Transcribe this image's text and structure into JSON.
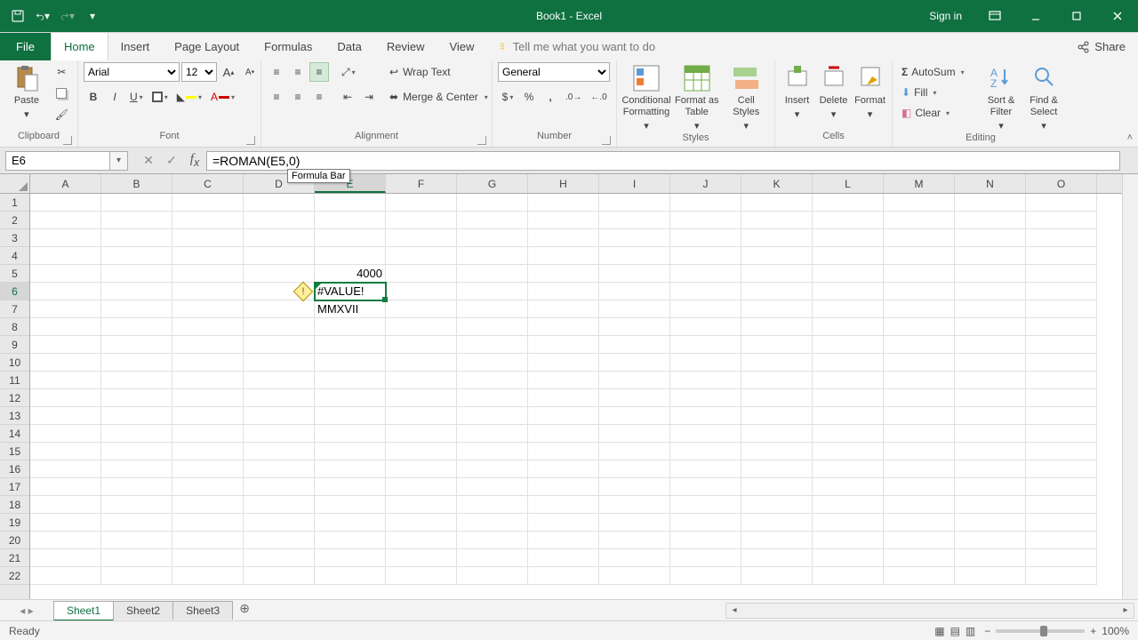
{
  "titlebar": {
    "title": "Book1 - Excel",
    "signin": "Sign in"
  },
  "tabs": {
    "file": "File",
    "home": "Home",
    "insert": "Insert",
    "pagelayout": "Page Layout",
    "formulas": "Formulas",
    "data": "Data",
    "review": "Review",
    "view": "View",
    "tellme": "Tell me what you want to do",
    "share": "Share"
  },
  "ribbon": {
    "clipboard": {
      "paste": "Paste",
      "label": "Clipboard"
    },
    "font": {
      "name": "Arial",
      "size": "12",
      "label": "Font"
    },
    "alignment": {
      "wrap": "Wrap Text",
      "merge": "Merge & Center",
      "label": "Alignment"
    },
    "number": {
      "format": "General",
      "label": "Number"
    },
    "styles": {
      "cond": "Conditional Formatting",
      "table": "Format as Table",
      "cell": "Cell Styles",
      "label": "Styles"
    },
    "cells": {
      "insert": "Insert",
      "delete": "Delete",
      "format": "Format",
      "label": "Cells"
    },
    "editing": {
      "sum": "AutoSum",
      "fill": "Fill",
      "clear": "Clear",
      "sort": "Sort & Filter",
      "find": "Find & Select",
      "label": "Editing"
    }
  },
  "fbar": {
    "nameref": "E6",
    "formula": "=ROMAN(E5,0)",
    "tooltip": "Formula Bar"
  },
  "grid": {
    "cols": [
      "A",
      "B",
      "C",
      "D",
      "E",
      "F",
      "G",
      "H",
      "I",
      "J",
      "K",
      "L",
      "M",
      "N",
      "O"
    ],
    "selectedCol": "E",
    "selectedRow": "6",
    "cells": {
      "E5": "4000",
      "E6": "#VALUE!",
      "E7": "MMXVII"
    }
  },
  "sheets": {
    "s1": "Sheet1",
    "s2": "Sheet2",
    "s3": "Sheet3"
  },
  "status": {
    "ready": "Ready",
    "zoom": "100%"
  },
  "chart_data": null
}
